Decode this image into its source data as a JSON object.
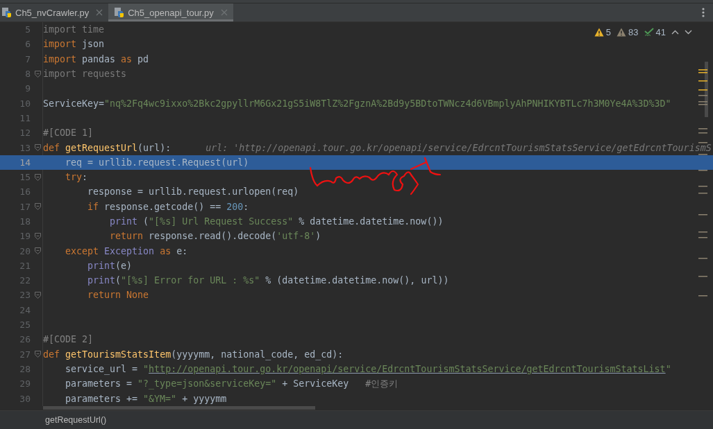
{
  "tabs": [
    {
      "label": "Ch5_nvCrawler.py",
      "selected": false
    },
    {
      "label": "Ch5_openapi_tour.py",
      "selected": true
    }
  ],
  "inspections": [
    {
      "kind": "warning",
      "count": "5"
    },
    {
      "kind": "weak",
      "count": "83"
    },
    {
      "kind": "typo",
      "count": "41"
    }
  ],
  "lines": [
    {
      "number": "5",
      "fold": false,
      "selected": false,
      "tokens": [
        {
          "kind": "dim",
          "text": "import time"
        }
      ]
    },
    {
      "number": "6",
      "fold": false,
      "selected": false,
      "tokens": [
        {
          "kind": "kw",
          "text": "import"
        },
        {
          "kind": "id",
          "text": " json"
        }
      ]
    },
    {
      "number": "7",
      "fold": false,
      "selected": false,
      "tokens": [
        {
          "kind": "kw",
          "text": "import"
        },
        {
          "kind": "id",
          "text": " pandas "
        },
        {
          "kind": "kw",
          "text": "as"
        },
        {
          "kind": "id",
          "text": " pd"
        }
      ]
    },
    {
      "number": "8",
      "fold": true,
      "selected": false,
      "tokens": [
        {
          "kind": "dim",
          "text": "import requests"
        }
      ]
    },
    {
      "number": "9",
      "fold": false,
      "selected": false
    },
    {
      "number": "10",
      "fold": false,
      "selected": false,
      "tokens": [
        {
          "kind": "id",
          "text": "ServiceKey="
        },
        {
          "kind": "str",
          "text": "\"nq%2Fq4wc9ixxo%2Bkc2gpyllrM6Gx21gS5iW8TlZ%2FgznA%2Bd9y5BDtoTWNcz4d6VBmplyAhPNHIKYBTLc7h3M0Ye4A%3D%3D\""
        }
      ]
    },
    {
      "number": "11",
      "fold": false,
      "selected": false
    },
    {
      "number": "12",
      "fold": false,
      "selected": false,
      "tokens": [
        {
          "kind": "cmt",
          "text": "#[CODE 1]"
        }
      ]
    },
    {
      "number": "13",
      "fold": true,
      "selected": false,
      "tokens": [
        {
          "kind": "kw",
          "text": "def"
        },
        {
          "kind": "def",
          "text": " getRequestUrl"
        },
        {
          "kind": "id",
          "text": "(url):"
        },
        {
          "kind": "hint",
          "text": "url: 'http://openapi.tour.go.kr/openapi/service/EdrcntTourismStatsService/getEdrcntTourismS"
        }
      ],
      "children": [
        {
          "number": "14",
          "fold": false,
          "selected": true,
          "tokens": [
            {
              "kind": "id",
              "text": "req = urllib.request.Request(url)"
            }
          ]
        },
        {
          "number": "15",
          "fold": true,
          "selected": false,
          "tokens": [
            {
              "kind": "kw",
              "text": "try"
            },
            {
              "kind": "id",
              "text": ":"
            }
          ],
          "children": [
            {
              "number": "16",
              "fold": false,
              "selected": false,
              "tokens": [
                {
                  "kind": "id",
                  "text": "response = urllib.request.urlopen(req)"
                }
              ]
            },
            {
              "number": "17",
              "fold": true,
              "selected": false,
              "tokens": [
                {
                  "kind": "kw",
                  "text": "if"
                },
                {
                  "kind": "id",
                  "text": " response.getcode() == "
                },
                {
                  "kind": "num",
                  "text": "200"
                },
                {
                  "kind": "id",
                  "text": ":"
                }
              ],
              "children": [
                {
                  "number": "18",
                  "fold": false,
                  "selected": false,
                  "tokens": [
                    {
                      "kind": "builtin",
                      "text": "print"
                    },
                    {
                      "kind": "id",
                      "text": " ("
                    },
                    {
                      "kind": "str",
                      "text": "\"[%s] Url Request Success\""
                    },
                    {
                      "kind": "id",
                      "text": " % datetime.datetime.now())"
                    }
                  ]
                },
                {
                  "number": "19",
                  "fold": true,
                  "selected": false,
                  "tokens": [
                    {
                      "kind": "kw",
                      "text": "return"
                    },
                    {
                      "kind": "id",
                      "text": " response.read().decode("
                    },
                    {
                      "kind": "str",
                      "text": "'utf-8'"
                    },
                    {
                      "kind": "id",
                      "text": ")"
                    }
                  ]
                }
              ]
            }
          ]
        },
        {
          "number": "20",
          "fold": true,
          "selected": false,
          "tokens": [
            {
              "kind": "kw",
              "text": "except"
            },
            {
              "kind": "builtin",
              "text": " Exception"
            },
            {
              "kind": "kw",
              "text": " as"
            },
            {
              "kind": "id",
              "text": " e:"
            }
          ],
          "children": [
            {
              "number": "21",
              "fold": false,
              "selected": false,
              "tokens": [
                {
                  "kind": "builtin",
                  "text": "print"
                },
                {
                  "kind": "id",
                  "text": "(e)"
                }
              ]
            },
            {
              "number": "22",
              "fold": false,
              "selected": false,
              "tokens": [
                {
                  "kind": "builtin",
                  "text": "print"
                },
                {
                  "kind": "id",
                  "text": "("
                },
                {
                  "kind": "str",
                  "text": "\"[%s] Error for URL : %s\""
                },
                {
                  "kind": "id",
                  "text": " % (datetime.datetime.now(), url))"
                }
              ]
            },
            {
              "number": "23",
              "fold": true,
              "selected": false,
              "tokens": [
                {
                  "kind": "kw",
                  "text": "return None"
                }
              ]
            }
          ]
        }
      ]
    },
    {
      "number": "24",
      "fold": false,
      "selected": false
    },
    {
      "number": "25",
      "fold": false,
      "selected": false
    },
    {
      "number": "26",
      "fold": false,
      "selected": false,
      "tokens": [
        {
          "kind": "cmt",
          "text": "#[CODE 2]"
        }
      ]
    },
    {
      "number": "27",
      "fold": true,
      "selected": false,
      "tokens": [
        {
          "kind": "kw",
          "text": "def"
        },
        {
          "kind": "def",
          "text": " getTourismStatsItem"
        },
        {
          "kind": "id",
          "text": "(yyyymm, national_code, ed_cd):"
        }
      ],
      "children": [
        {
          "number": "28",
          "fold": false,
          "selected": false,
          "tokens": [
            {
              "kind": "id",
              "text": "service_url = "
            },
            {
              "kind": "str",
              "text": "\""
            },
            {
              "kind": "link",
              "text": "http://openapi.tour.go.kr/openapi/service/EdrcntTourismStatsService/getEdrcntTourismStatsList"
            },
            {
              "kind": "str",
              "text": "\""
            }
          ]
        },
        {
          "number": "29",
          "fold": false,
          "selected": false,
          "tokens": [
            {
              "kind": "id",
              "text": "parameters = "
            },
            {
              "kind": "str",
              "text": "\"?_type=json&serviceKey=\""
            },
            {
              "kind": "id",
              "text": " + ServiceKey"
            },
            {
              "kind": "cmt",
              "text": "#인증키"
            }
          ]
        },
        {
          "number": "30",
          "fold": false,
          "selected": false,
          "tokens": [
            {
              "kind": "id",
              "text": "parameters += "
            },
            {
              "kind": "str",
              "text": "\"&YM=\""
            },
            {
              "kind": "id",
              "text": " + yyyymm"
            }
          ]
        }
      ]
    }
  ],
  "breadcrumb": "getRequestUrl()"
}
